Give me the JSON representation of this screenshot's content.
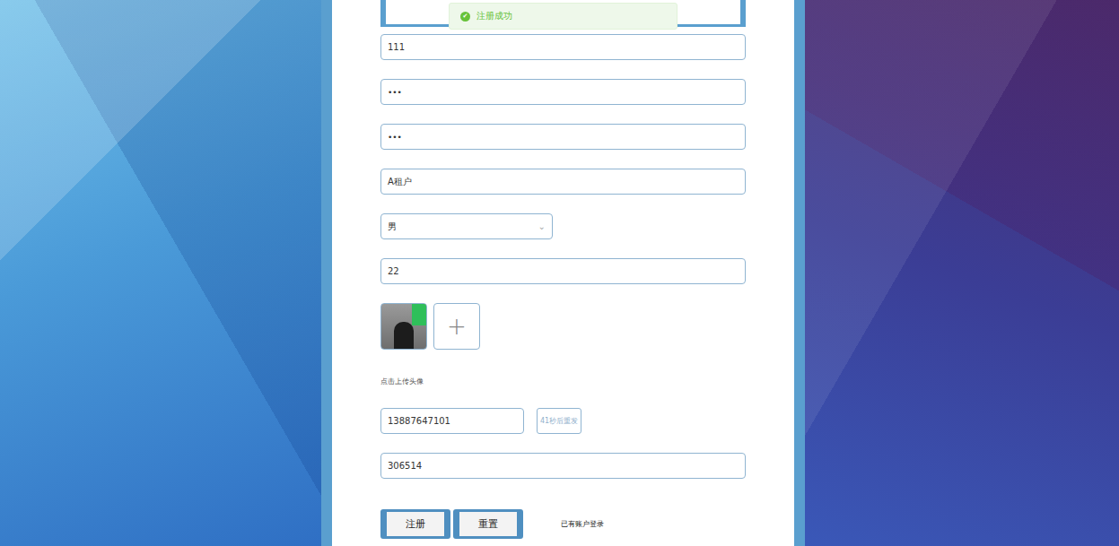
{
  "toast": {
    "icon": "✔",
    "text": "注册成功"
  },
  "form": {
    "fields": [
      {
        "name": "account",
        "kind": "text",
        "value": "111"
      },
      {
        "name": "password",
        "kind": "password",
        "value": "•••"
      },
      {
        "name": "confirm-password",
        "kind": "password",
        "value": "•••"
      },
      {
        "name": "real-name",
        "kind": "text",
        "value": "A租户"
      },
      {
        "name": "gender",
        "kind": "select",
        "value": "男",
        "chevron": "⌄"
      },
      {
        "name": "age",
        "kind": "text",
        "value": "22"
      }
    ],
    "avatar": {
      "has_photo": true,
      "add": "+",
      "hint": "点击上传头像"
    },
    "phone": {
      "value": "13887647101",
      "send": {
        "label": "41秒后重发",
        "disabled": true
      }
    },
    "code": {
      "value": "306514"
    },
    "buttons": [
      "注册",
      "重置"
    ],
    "login_link": "已有账户登录"
  }
}
